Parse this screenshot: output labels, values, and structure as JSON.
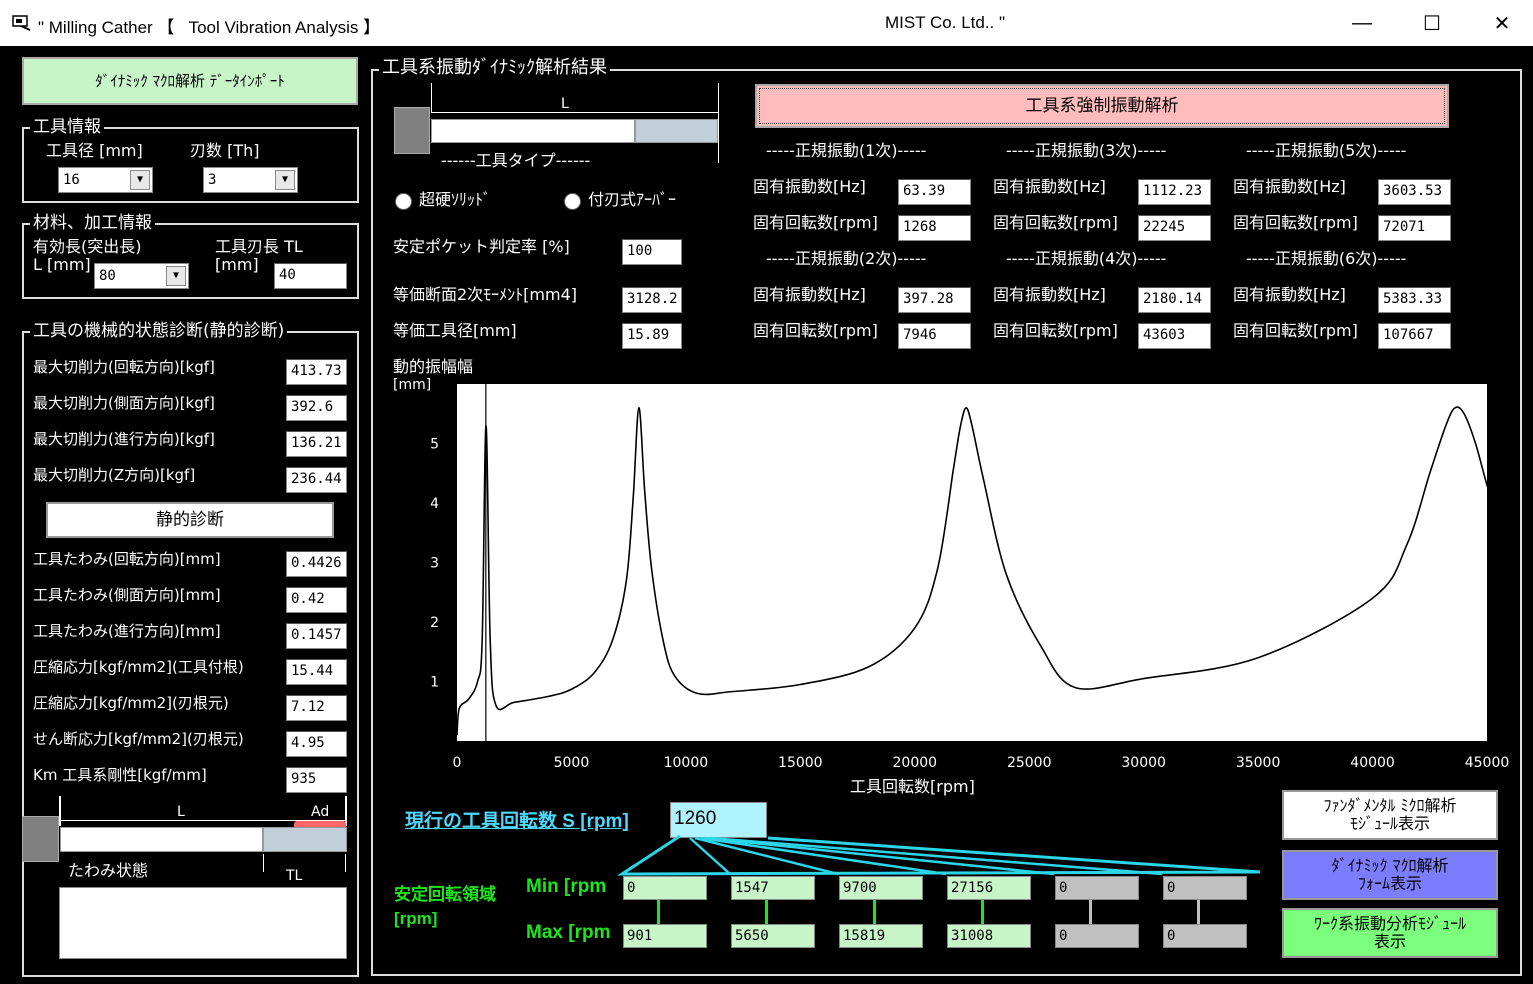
{
  "window": {
    "title": "\" Milling Cather 【   Tool Vibration Analysis 】",
    "company": "MIST Co. Ltd.. \""
  },
  "import_button": "ﾀﾞｲﾅﾐｯｸ ﾏｸﾛ解析  ﾃﾞｰﾀｲﾝﾎﾟｰﾄ",
  "tool_info": {
    "title": "工具情報",
    "diameter_label": "工具径 [mm]",
    "teeth_label": "刃数 [Th]",
    "diameter_value": "16",
    "teeth_value": "3"
  },
  "material": {
    "title": "材料、加工情報",
    "length_label1": "有効長(突出長)",
    "length_label2": "L [mm]",
    "length_value": "80",
    "blade_label1": "工具刃長 TL",
    "blade_label2": "[mm]",
    "blade_value": "40"
  },
  "static": {
    "title": "工具の機械的状態診断(静的診断)",
    "forces": [
      {
        "label": "最大切削力(回転方向)[kgf]",
        "value": "413.73"
      },
      {
        "label": "最大切削力(側面方向)[kgf]",
        "value": "392.6"
      },
      {
        "label": "最大切削力(進行方向)[kgf]",
        "value": "136.21"
      },
      {
        "label": "最大切削力(Z方向)[kgf]",
        "value": "236.44"
      }
    ],
    "diag_button": "静的診断",
    "results": [
      {
        "label": "工具たわみ(回転方向)[mm]",
        "value": "0.4426"
      },
      {
        "label": "工具たわみ(側面方向)[mm]",
        "value": "0.42"
      },
      {
        "label": "工具たわみ(進行方向)[mm]",
        "value": "0.1457"
      },
      {
        "label": "圧縮応力[kgf/mm2](工具付根)",
        "value": "15.44"
      },
      {
        "label": "圧縮応力[kgf/mm2](刃根元)",
        "value": "7.12"
      },
      {
        "label": "せん断応力[kgf/mm2](刃根元)",
        "value": "4.95"
      },
      {
        "label": "Km 工具系剛性[kgf/mm]",
        "value": "935"
      }
    ],
    "diagram_L": "L",
    "diagram_Ad": "Ad",
    "diagram_TL": "TL",
    "deflection_label": "たわみ状態"
  },
  "dynamic": {
    "title": "工具系振動ﾀﾞｲﾅﾐｯｸ解析結果",
    "tool_L": "L",
    "tool_type": "------工具タイプ------",
    "radio_solid": "超硬ｿﾘｯﾄﾞ",
    "radio_arbor": "付刃式ｱｰﾊﾞｰ",
    "forced_button": "工具系強制振動解析",
    "pocket_label": "安定ポケット判定率  [%]",
    "pocket_value": "100",
    "moment_label": "等価断面2次ﾓｰﾒﾝﾄ[mm4]",
    "moment_value": "3128.2",
    "equiv_label": "等価工具径[mm]",
    "equiv_value": "15.89",
    "freq_label": "固有振動数[Hz]",
    "rpm_label": "固有回転数[rpm]",
    "modes": [
      {
        "header": "-----正規振動(1次)-----",
        "hz": "63.39",
        "rpm": "1268"
      },
      {
        "header": "-----正規振動(2次)-----",
        "hz": "397.28",
        "rpm": "7946"
      },
      {
        "header": "-----正規振動(3次)-----",
        "hz": "1112.23",
        "rpm": "22245"
      },
      {
        "header": "-----正規振動(4次)-----",
        "hz": "2180.14",
        "rpm": "43603"
      },
      {
        "header": "-----正規振動(5次)-----",
        "hz": "3603.53",
        "rpm": "72071"
      },
      {
        "header": "-----正規振動(6次)-----",
        "hz": "5383.33",
        "rpm": "107667"
      }
    ],
    "current_speed_label": "現行の工具回転数 S [rpm]",
    "current_speed_value": "1260",
    "stable_label1": "安定回転領域",
    "stable_label2": "[rpm]",
    "min_label": "Min [rpm",
    "max_label": "Max [rpm",
    "ranges": [
      {
        "min": "0",
        "max": "901",
        "active": true
      },
      {
        "min": "1547",
        "max": "5650",
        "active": true
      },
      {
        "min": "9700",
        "max": "15819",
        "active": true
      },
      {
        "min": "27156",
        "max": "31008",
        "active": true
      },
      {
        "min": "0",
        "max": "0",
        "active": false
      },
      {
        "min": "0",
        "max": "0",
        "active": false
      }
    ],
    "btn_micro": "ﾌｧﾝﾀﾞﾒﾝﾀﾙ  ﾐｸﾛ解析\nﾓｼﾞｭｰﾙ表示",
    "btn_macro": "ﾀﾞｲﾅﾐｯｸ ﾏｸﾛ解析\nﾌｫｰﾑ表示",
    "btn_work": "ﾜｰｸ系振動分析ﾓｼﾞｭｰﾙ\n表示"
  },
  "chart_data": {
    "type": "line",
    "title": "",
    "ylabel": "動的振幅幅",
    "yunit": "[mm]",
    "xlabel": "工具回転数[rpm]",
    "xlim": [
      0,
      45000
    ],
    "ylim": [
      0,
      6
    ],
    "xticks": [
      0,
      5000,
      10000,
      15000,
      20000,
      25000,
      30000,
      35000,
      40000,
      45000
    ],
    "yticks": [
      1,
      2,
      3,
      4,
      5
    ],
    "marker_x": 1260,
    "series": [
      {
        "x": [
          0,
          100,
          500,
          900,
          1100,
          1268,
          1450,
          1700,
          2500,
          4000,
          5000,
          6000,
          6800,
          7400,
          7700,
          7946,
          8200,
          8500,
          9000,
          9500,
          10500,
          12000,
          15000,
          18000,
          20000,
          21000,
          21700,
          22000,
          22245,
          22500,
          23000,
          24000,
          25500,
          27000,
          30000,
          35000,
          40000,
          41500,
          42500,
          43200,
          43603,
          44000,
          44500,
          45000,
          45300
        ],
        "y": [
          0.1,
          0.55,
          0.7,
          1.0,
          1.7,
          5.3,
          1.7,
          0.6,
          0.65,
          0.75,
          0.87,
          1.15,
          1.7,
          2.7,
          4.1,
          5.6,
          4.2,
          2.9,
          1.7,
          1.1,
          0.8,
          0.83,
          0.95,
          1.25,
          1.9,
          2.9,
          4.6,
          5.3,
          5.6,
          5.3,
          4.4,
          2.8,
          1.6,
          0.9,
          1.05,
          1.4,
          2.4,
          3.3,
          4.5,
          5.3,
          5.6,
          5.5,
          5.0,
          4.3,
          4.0
        ]
      }
    ]
  }
}
